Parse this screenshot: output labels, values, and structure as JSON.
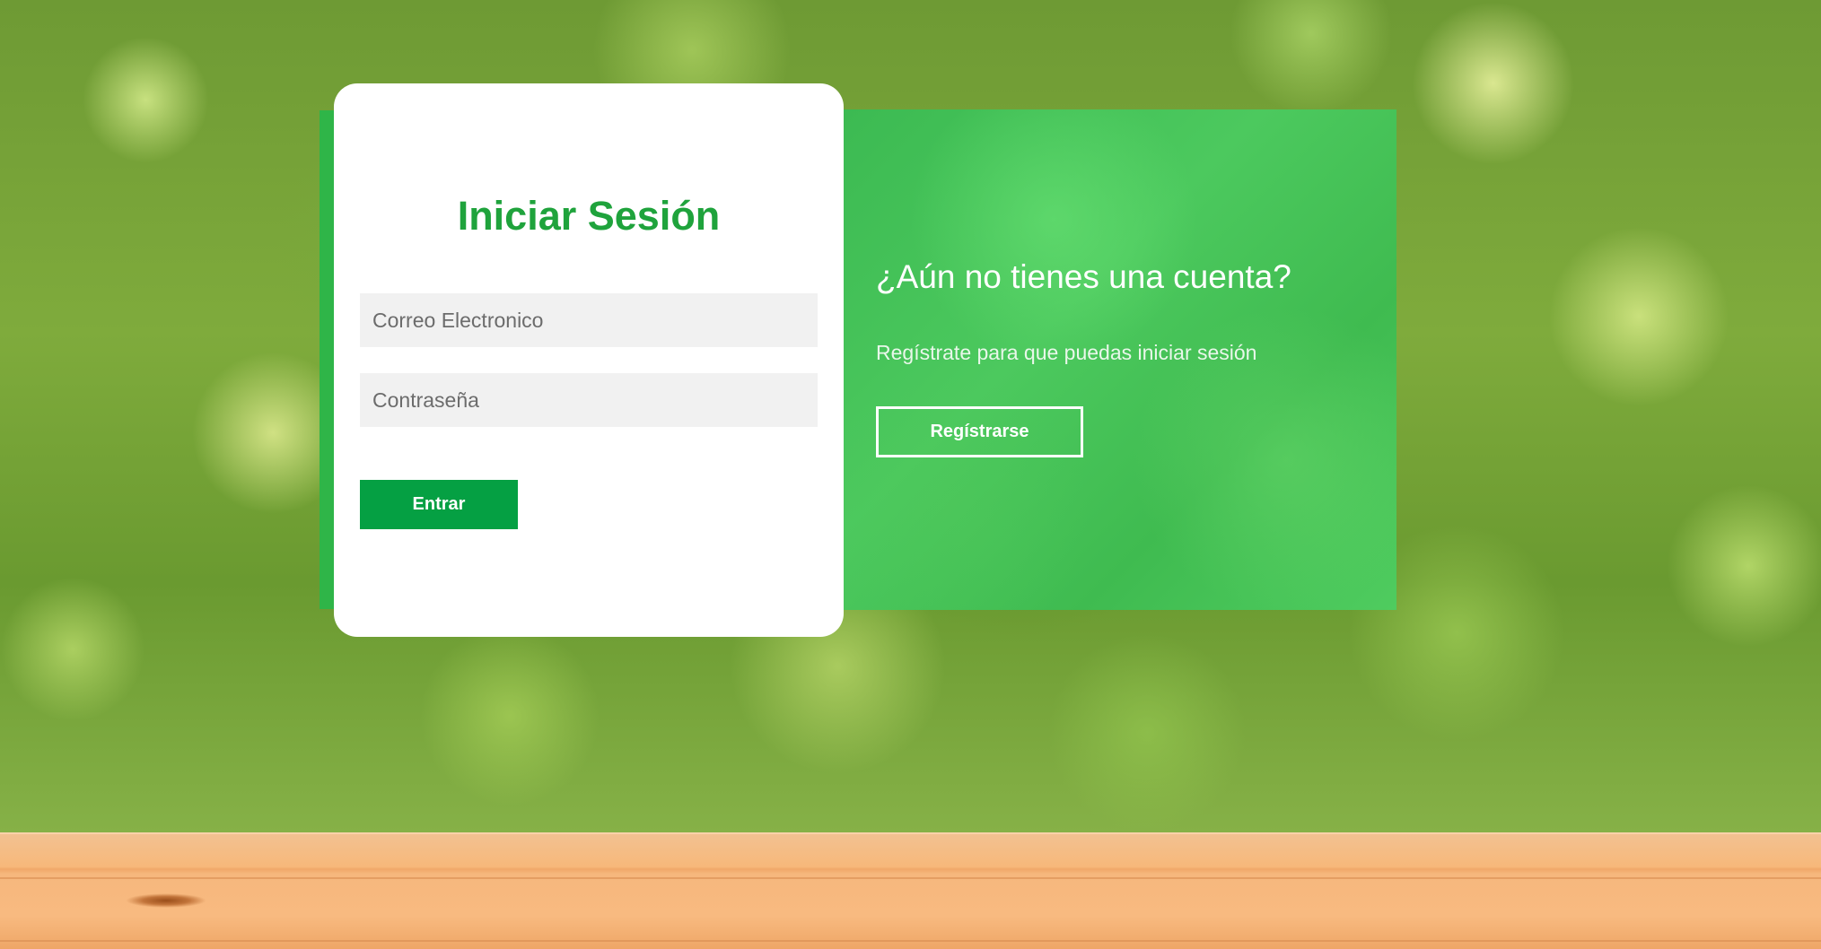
{
  "login": {
    "title": "Iniciar Sesión",
    "email_placeholder": "Correo Electronico",
    "password_placeholder": "Contraseña",
    "submit_label": "Entrar"
  },
  "register": {
    "title": "¿Aún no tienes una cuenta?",
    "text": "Regístrate para que puedas iniciar sesión",
    "button_label": "Regístrarse"
  },
  "colors": {
    "brand_green": "#05a043",
    "title_green": "#1fa33c",
    "panel_green": "#3cba52"
  }
}
